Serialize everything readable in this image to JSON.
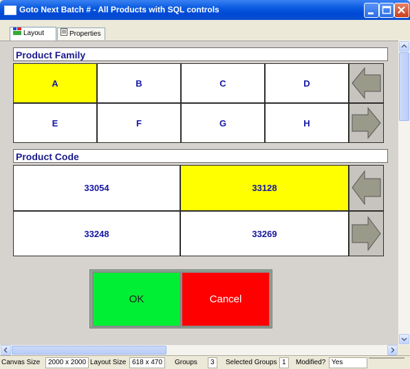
{
  "window": {
    "title": "Goto Next Batch # - All Products with SQL controls"
  },
  "tabs": [
    {
      "label": "Layout",
      "icon": "layout-icon"
    },
    {
      "label": "Properties",
      "icon": "properties-icon"
    }
  ],
  "product_family": {
    "title": "Product Family",
    "cells": [
      "A",
      "B",
      "C",
      "D",
      "E",
      "F",
      "G",
      "H"
    ],
    "selected": "A"
  },
  "product_code": {
    "title": "Product Code",
    "cells": [
      "33054",
      "33128",
      "33248",
      "33269"
    ],
    "selected": "33128"
  },
  "actions": {
    "ok_label": "OK",
    "cancel_label": "Cancel"
  },
  "statusbar": {
    "canvas_size_label": "Canvas Size",
    "canvas_size_value": "2000 x 2000",
    "layout_size_label": "Layout Size",
    "layout_size_value": "618 x 470",
    "groups_label": "Groups",
    "groups_value": "3",
    "selected_groups_label": "Selected Groups",
    "selected_groups_value": "1",
    "modified_label": "Modified?",
    "modified_value": "Yes"
  },
  "colors": {
    "selected": "#ffff00",
    "ok": "#00ee33",
    "cancel": "#ff0000",
    "title_bar": "#0a5ae0"
  }
}
